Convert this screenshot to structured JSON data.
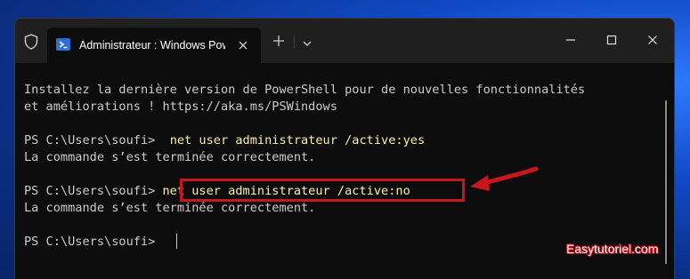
{
  "window": {
    "tab_title": "Administrateur : Windows PowerShell"
  },
  "terminal": {
    "lines": [
      "Installez la dernière version de PowerShell pour de nouvelles fonctionnalités",
      "et améliorations ! https://aka.ms/PSWindows",
      "",
      "PS C:\\Users\\soufi> ",
      "La commande s’est terminée correctement.",
      "",
      "PS C:\\Users\\soufi> ",
      "La commande s’est terminée correctement.",
      "",
      "PS C:\\Users\\soufi> "
    ],
    "commands": {
      "cmd1": "net user administrateur /active:yes",
      "cmd2": "net user administrateur /active:no"
    }
  },
  "watermark": "Easytutoriel.com",
  "colors": {
    "terminal_bg": "#0c0c0c",
    "terminal_text": "#cccccc",
    "command_text": "#f9f1a5",
    "highlight": "#c8161d",
    "titlebar_bg": "#1f1f1f"
  },
  "icons": {
    "shield": "shield-icon",
    "powershell": "powershell-icon",
    "close": "close-icon",
    "plus": "plus-icon",
    "chevron": "chevron-down-icon",
    "minimize": "minimize-icon",
    "maximize": "maximize-icon"
  }
}
